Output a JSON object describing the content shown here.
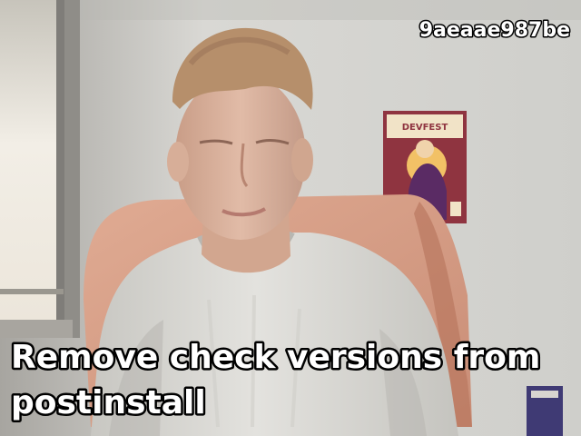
{
  "overlay": {
    "commit_id": "9aeaae987be",
    "caption_line_1": "Remove check versions from",
    "caption_line_2": "postinstall"
  },
  "poster": {
    "title": "DEVFEST"
  },
  "colors": {
    "wall": "#d7d6d1",
    "window_light": "#f4f1e9",
    "chair": "#d99d85",
    "shirt": "#d9d8d3",
    "skin": "#d8b19c",
    "hair": "#b6916e",
    "poster_bg": "#8f3440"
  }
}
